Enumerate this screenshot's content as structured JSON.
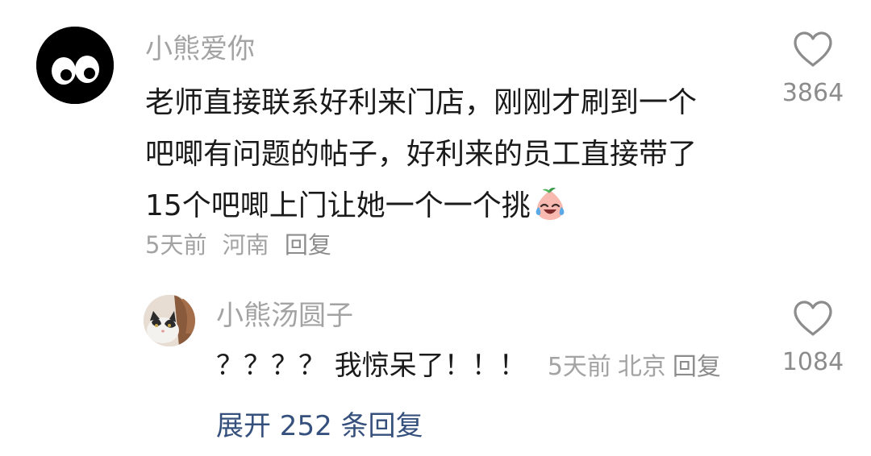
{
  "comment": {
    "username": "小熊爱你",
    "avatar_icon": "cartoon-eyes-avatar",
    "lines": [
      "老师直接联系好利来门店，刚刚才刷到一个",
      "吧唧有问题的帖子，好利来的员工直接带了",
      "15个吧唧上门让她一个一个挑"
    ],
    "emoji": "crying-laughing-emoji",
    "time": "5天前",
    "location": "河南",
    "reply_label": "回复",
    "like_count": "3864"
  },
  "reply": {
    "username": "小熊汤圆子",
    "avatar_icon": "cat-photo-avatar",
    "text": "？？？？ 我惊呆了！！！",
    "time": "5天前",
    "location": "北京",
    "reply_label": "回复",
    "like_count": "1084"
  },
  "expand_label": "展开 252 条回复",
  "colors": {
    "name": "#a3a3a3",
    "body": "#1a1a1a",
    "meta": "#a3a3a3",
    "link": "#36507d"
  }
}
